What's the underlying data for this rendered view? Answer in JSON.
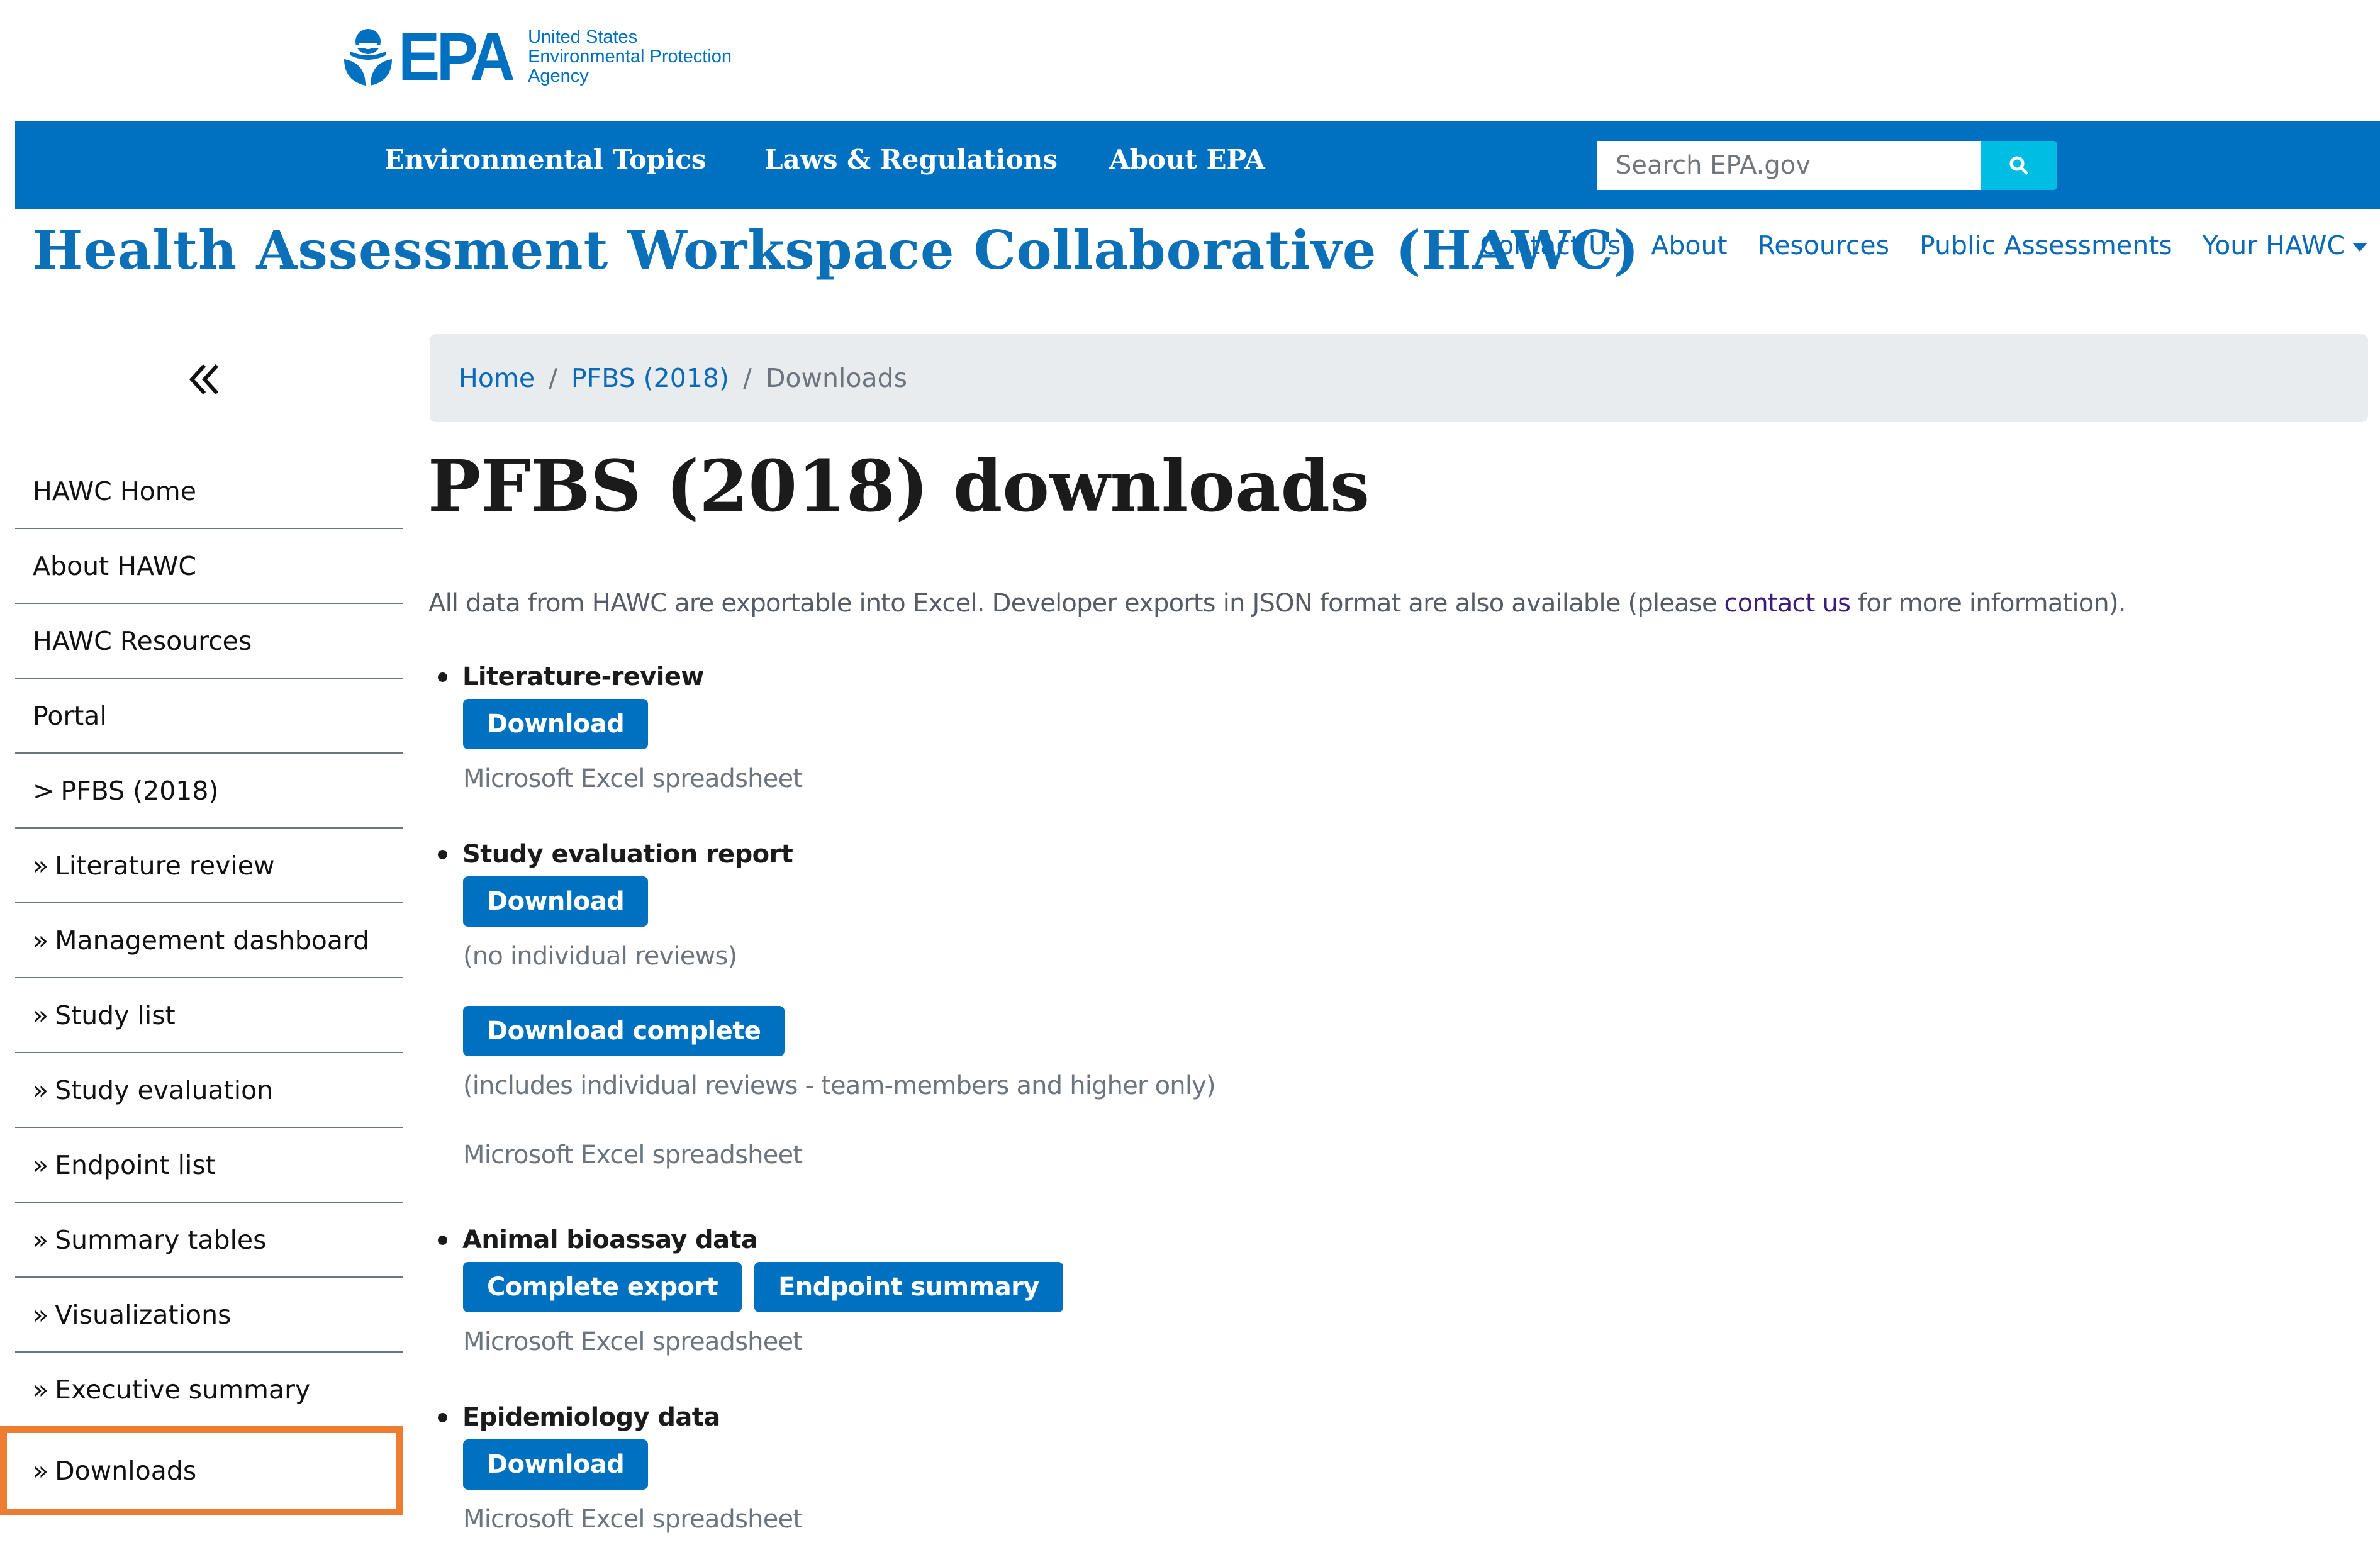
{
  "epa": {
    "logo_text": "EPA",
    "agency_name_lines": [
      "United States",
      "Environmental Protection",
      "Agency"
    ]
  },
  "topnav": {
    "links": [
      "Environmental Topics",
      "Laws & Regulations",
      "About EPA"
    ],
    "search": {
      "placeholder": "Search EPA.gov",
      "value": ""
    }
  },
  "header": {
    "title": "Health Assessment Workspace Collaborative (HAWC)",
    "nav": [
      "Contact Us",
      "About",
      "Resources",
      "Public Assessments",
      "Your HAWC"
    ]
  },
  "sidebar": {
    "collapse_icon": "double-chevron-left-icon",
    "items": [
      {
        "label": "HAWC Home",
        "prefix": ""
      },
      {
        "label": "About HAWC",
        "prefix": ""
      },
      {
        "label": "HAWC Resources",
        "prefix": ""
      },
      {
        "label": "Portal",
        "prefix": ""
      },
      {
        "label": "PFBS (2018)",
        "prefix": ">"
      },
      {
        "label": "Literature review",
        "prefix": "»"
      },
      {
        "label": "Management dashboard",
        "prefix": "»"
      },
      {
        "label": "Study list",
        "prefix": "»"
      },
      {
        "label": "Study evaluation",
        "prefix": "»"
      },
      {
        "label": "Endpoint list",
        "prefix": "»"
      },
      {
        "label": "Summary tables",
        "prefix": "»"
      },
      {
        "label": "Visualizations",
        "prefix": "»"
      },
      {
        "label": "Executive summary",
        "prefix": "»"
      },
      {
        "label": "Downloads",
        "prefix": "»",
        "active": true
      }
    ],
    "highlight_color": "#ed7d31"
  },
  "breadcrumb": {
    "items": [
      "Home",
      "PFBS (2018)"
    ],
    "current": "Downloads",
    "separator": "/"
  },
  "main": {
    "title": "PFBS (2018) downloads",
    "intro_before": "All data from HAWC are exportable into Excel. Developer exports in JSON format are also available (please ",
    "intro_link": "contact us",
    "intro_after": " for more information).",
    "sections": [
      {
        "heading": "Literature-review",
        "buttons": [
          "Download"
        ],
        "note": "Microsoft Excel spreadsheet"
      },
      {
        "heading": "Study evaluation report",
        "buttons": [
          "Download"
        ],
        "note": "(no individual reviews)",
        "buttons2": [
          "Download complete"
        ],
        "note2": "(includes individual reviews - team-members and higher only)",
        "note3": "Microsoft Excel spreadsheet"
      },
      {
        "heading": "Animal bioassay data",
        "buttons": [
          "Complete export",
          "Endpoint summary"
        ],
        "note": "Microsoft Excel spreadsheet"
      },
      {
        "heading": "Epidemiology data",
        "buttons": [
          "Download"
        ],
        "note": "Microsoft Excel spreadsheet"
      }
    ]
  },
  "colors": {
    "primary": "#0070c0",
    "search_button": "#00bde3",
    "link": "#0b6ab8",
    "visited_link": "#3a1c7f",
    "breadcrumb_bg": "#e9ecef"
  }
}
